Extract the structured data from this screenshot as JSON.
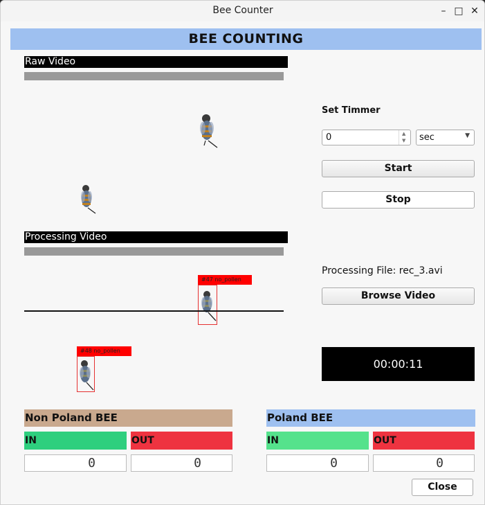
{
  "window": {
    "title": "Bee Counter",
    "controls": {
      "minimize": "–",
      "maximize": "□",
      "close": "✕"
    }
  },
  "header": {
    "title": "BEE COUNTING"
  },
  "raw_video": {
    "label": "Raw Video"
  },
  "processing_video": {
    "label": "Processing Video",
    "detections": [
      {
        "tag": "#47  no_pollen"
      },
      {
        "tag": "#48  no_pollen"
      }
    ]
  },
  "timer": {
    "label": "Set Timmer",
    "value": "0",
    "unit": "sec"
  },
  "buttons": {
    "start": "Start",
    "stop": "Stop",
    "browse": "Browse Video",
    "close": "Close"
  },
  "processing_file": "Processing File: rec_3.avi",
  "clock": "00:00:11",
  "counters": {
    "non_poland": {
      "title": "Non Poland BEE",
      "in_label": "IN",
      "out_label": "OUT",
      "in_value": "0",
      "out_value": "0"
    },
    "poland": {
      "title": "Poland BEE",
      "in_label": "IN",
      "out_label": "OUT",
      "in_value": "0",
      "out_value": "0"
    }
  },
  "colors": {
    "header_bg": "#9ec0f0",
    "non_poland_bg": "#c9a98e",
    "poland_bg": "#9ec0f0",
    "in_non_poland": "#2ecf7e",
    "in_poland": "#55e28c",
    "out_bg": "#ee3340",
    "detection_red": "#ff0000"
  },
  "icons": {
    "bee": "bee-icon",
    "spin_up": "chevron-up-icon",
    "spin_down": "chevron-down-icon",
    "dropdown": "chevron-down-icon"
  }
}
